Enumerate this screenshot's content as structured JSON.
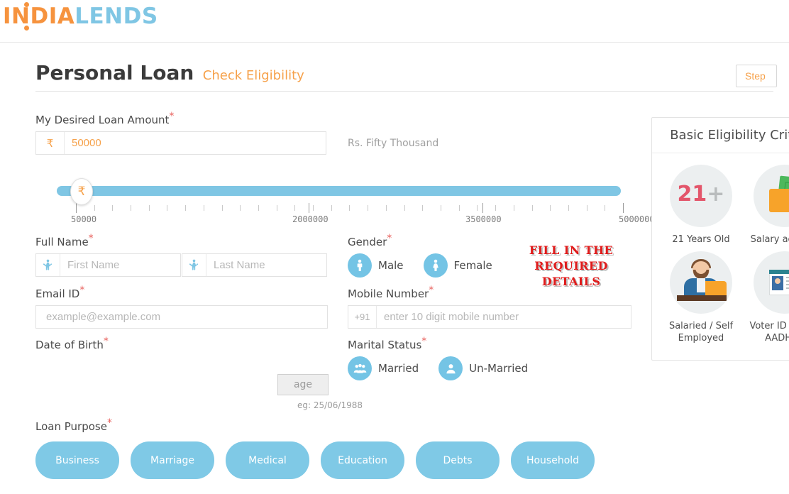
{
  "brand": {
    "name_part1": "INDIA",
    "name_part2": "LENDS",
    "logo_icon": "indialends-logo"
  },
  "header": {
    "title": "Personal Loan",
    "subtitle": "Check Eligibility",
    "step_button": "Step"
  },
  "form": {
    "loan_amount": {
      "label": "My Desired Loan Amount",
      "required_mark": "*",
      "currency_symbol": "₹",
      "value": "50000",
      "words": "Rs. Fifty Thousand"
    },
    "slider": {
      "handle_symbol": "₹",
      "min_label": "50000",
      "mid1_label": "2000000",
      "mid2_label": "3500000",
      "max_label": "5000000",
      "fill_percent": 100
    },
    "full_name": {
      "label": "Full Name",
      "required_mark": "*",
      "first_placeholder": "First Name",
      "first_value": "",
      "last_placeholder": "Last Name",
      "last_value": ""
    },
    "gender": {
      "label": "Gender",
      "required_mark": "*",
      "options": [
        {
          "label": "Male",
          "icon": "male-icon"
        },
        {
          "label": "Female",
          "icon": "female-icon"
        }
      ]
    },
    "email": {
      "label": "Email ID",
      "required_mark": "*",
      "placeholder": "example@example.com",
      "value": ""
    },
    "mobile": {
      "label": "Mobile Number",
      "required_mark": "*",
      "country_code": "+91",
      "placeholder": "enter 10 digit mobile number",
      "value": ""
    },
    "date_of_birth": {
      "label": "Date of Birth",
      "required_mark": "*",
      "age_placeholder": "age",
      "hint": "eg: 25/06/1988"
    },
    "marital_status": {
      "label": "Marital Status",
      "required_mark": "*",
      "options": [
        {
          "label": "Married",
          "icon": "married-icon"
        },
        {
          "label": "Un-Married",
          "icon": "single-person-icon"
        }
      ]
    },
    "loan_purpose": {
      "label": "Loan Purpose",
      "required_mark": "*",
      "options": [
        "Business",
        "Marriage",
        "Medical",
        "Education",
        "Debts",
        "Household"
      ]
    }
  },
  "annotation": {
    "line1": "FILL IN THE",
    "line2": "REQUIRED",
    "line3": "DETAILS"
  },
  "eligibility": {
    "title": "Basic Eligibility Criteria",
    "items": [
      {
        "caption": "21 Years Old",
        "icon": "age-21-plus-icon",
        "badge_number": "21",
        "badge_plus": "+"
      },
      {
        "caption": "Salary account",
        "icon": "wallet-cash-icon"
      },
      {
        "caption": "Salaried / Self Employed",
        "icon": "employee-desk-icon"
      },
      {
        "caption": "Voter ID / PAN / AADHAR",
        "icon": "id-card-icon"
      }
    ]
  },
  "colors": {
    "brand_orange": "#f6933e",
    "brand_blue": "#7fc6e4",
    "accent_red": "#e8615d",
    "annotation_red": "#e01b1b",
    "pill_blue": "#7fc9e6"
  }
}
